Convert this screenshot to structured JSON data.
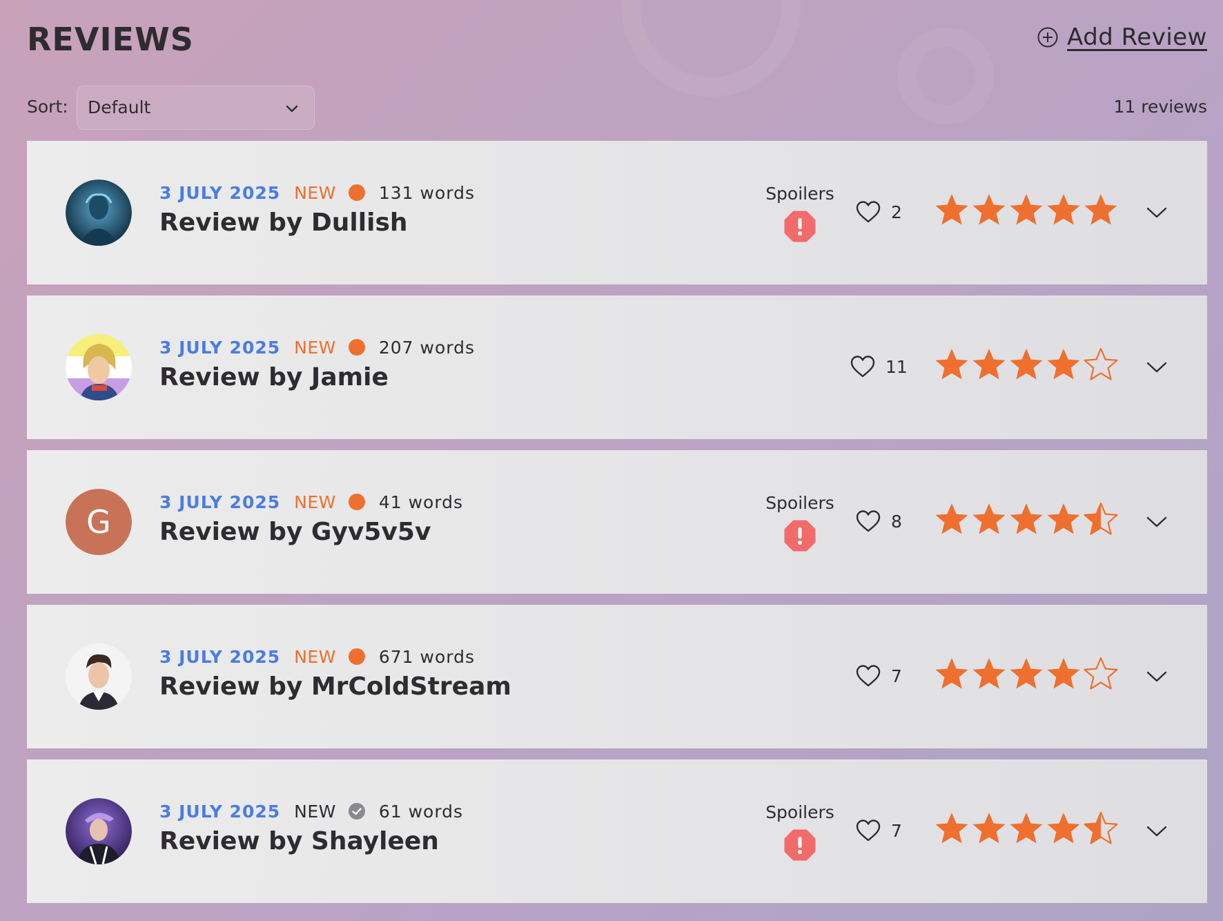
{
  "header": {
    "title": "REVIEWS",
    "add_review_label": "Add Review"
  },
  "sort": {
    "label": "Sort:",
    "selected": "Default"
  },
  "review_count": "11 reviews",
  "colors": {
    "date": "#4a7de0",
    "new_accent": "#ef6f2e",
    "star": "#ef6f2e",
    "spoiler_badge": "#f26b6b"
  },
  "reviews": [
    {
      "date": "3 JULY 2025",
      "new_label": "NEW",
      "status": "new",
      "words": "131 words",
      "title": "Review by Dullish",
      "spoilers": true,
      "spoilers_label": "Spoilers",
      "likes": "2",
      "rating": 5,
      "avatar": "photo-blue-figure"
    },
    {
      "date": "3 JULY 2025",
      "new_label": "NEW",
      "status": "new",
      "words": "207 words",
      "title": "Review by Jamie",
      "spoilers": false,
      "spoilers_label": "",
      "likes": "11",
      "rating": 4,
      "avatar": "illustration-blonde-character"
    },
    {
      "date": "3 JULY 2025",
      "new_label": "NEW",
      "status": "new",
      "words": "41 words",
      "title": "Review by Gyv5v5v",
      "spoilers": true,
      "spoilers_label": "Spoilers",
      "likes": "8",
      "rating": 4.5,
      "avatar_letter": "G"
    },
    {
      "date": "3 JULY 2025",
      "new_label": "NEW",
      "status": "new",
      "words": "671 words",
      "title": "Review by MrColdStream",
      "spoilers": false,
      "spoilers_label": "",
      "likes": "7",
      "rating": 4,
      "avatar": "photo-man-portrait"
    },
    {
      "date": "3 JULY 2025",
      "new_label": "NEW",
      "status": "read",
      "words": "61 words",
      "title": "Review by Shayleen",
      "spoilers": true,
      "spoilers_label": "Spoilers",
      "likes": "7",
      "rating": 4.5,
      "avatar": "photo-purple-character"
    }
  ]
}
